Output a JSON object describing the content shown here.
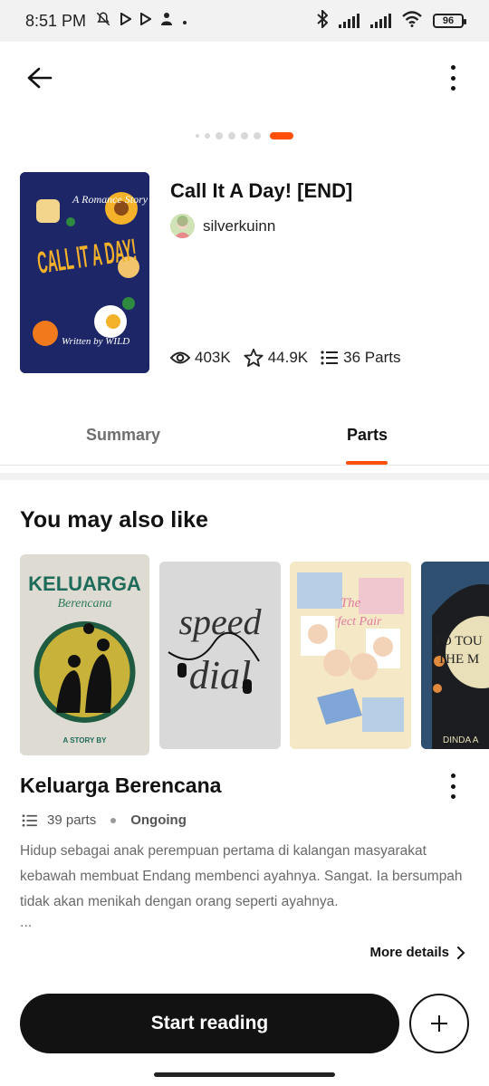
{
  "status_bar": {
    "time": "8:51 PM",
    "battery": "96",
    "icons": [
      "mute-icon",
      "play-icon",
      "play-icon",
      "person-icon",
      "bluetooth-icon",
      "signal-icon",
      "signal-icon",
      "wifi-icon",
      "battery-icon"
    ]
  },
  "story": {
    "title": "Call It A Day! [END]",
    "author": "silverkuinn",
    "reads": "403K",
    "votes": "44.9K",
    "parts": "36 Parts",
    "cover_text": {
      "tagline": "A Romance Story",
      "main": "CALL IT A DAY!",
      "credit": "Written by WILD"
    }
  },
  "tabs": {
    "summary": "Summary",
    "parts": "Parts",
    "active": "parts"
  },
  "recommendations": {
    "heading": "You may also like",
    "covers": [
      {
        "title_line1": "KELUARGA",
        "title_line2": "Berencana",
        "byline": "A STORY BY"
      },
      {
        "title_line1": "speed",
        "title_line2": "dial"
      },
      {
        "title_line1": "The",
        "title_line2": "Perfect Pair"
      },
      {
        "title_line1": "TO TOU",
        "title_line2": "THE M",
        "byline": "DINDA A"
      }
    ],
    "selected": {
      "title": "Keluarga Berencana",
      "parts": "39 parts",
      "status": "Ongoing",
      "description": "Hidup sebagai anak perempuan pertama di kalangan masyarakat kebawah membuat Endang membenci ayahnya. Sangat. Ia bersumpah tidak akan menikah dengan orang seperti ayahnya.",
      "ellipsis": "...",
      "more_details": "More details"
    }
  },
  "actions": {
    "start_reading": "Start reading"
  },
  "colors": {
    "accent": "#ff500a",
    "primary_button": "#121212"
  }
}
